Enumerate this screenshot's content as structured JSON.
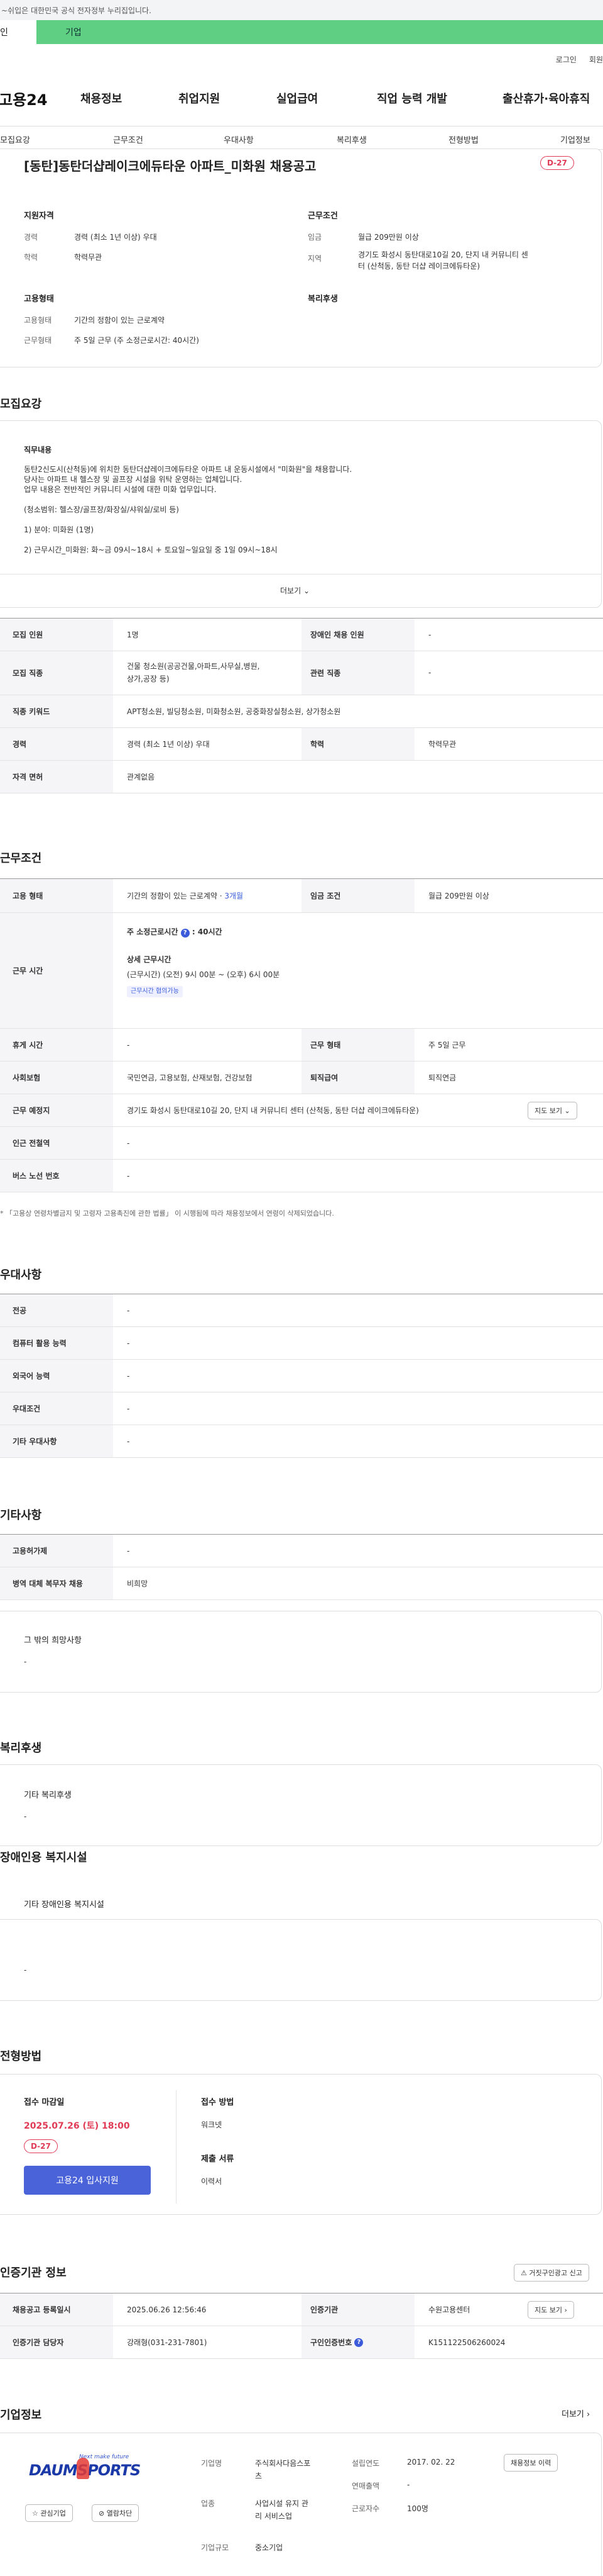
{
  "top_notice": "~쉬입은 대한민국 공식 전자정부 누리집입니다.",
  "service_tabs": {
    "personal": "인",
    "corporate": "기업"
  },
  "util": {
    "login": "로그인",
    "join": "회원"
  },
  "gnb": {
    "logo": "고용24",
    "menu": [
      "채용정보",
      "취업지원",
      "실업급여",
      "직업 능력 개발",
      "출산휴가·육아휴직"
    ]
  },
  "subnav": [
    "모집요강",
    "근무조건",
    "우대사항",
    "복리후생",
    "전형방법",
    "기업정보"
  ],
  "job": {
    "title": "[동탄]동탄더샵레이크에듀타운 아파트_미화원 채용공고",
    "dday": "D-27",
    "qual_heading": "지원자격",
    "career_k": "경력",
    "career_v": "경력 (최소 1년 이상) 우대",
    "edu_k": "학력",
    "edu_v": "학력무관",
    "cond_heading": "근무조건",
    "wage_k": "임금",
    "wage_v": "월급 209만원 이상",
    "area_k": "지역",
    "area_v1": "경기도 화성시 동탄대로10길 20, 단지 내 커뮤니티 센",
    "area_v2": "터 (산척동, 동탄 더샵 레이크에듀타운)",
    "emp_heading": "고용형태",
    "emptype_k": "고용형태",
    "emptype_v": "기간의 정함이 있는 근로계약",
    "worktype_k": "근무형태",
    "worktype_v": "주 5일 근무 (주 소정근로시간: 40시간)",
    "welfare_heading": "복리후생"
  },
  "recruit": {
    "heading": "모집요강",
    "duty_heading": "직무내용",
    "duty_lines": [
      "동탄2신도시(산척동)에 위치한 동탄더샵레이크에듀타운 아파트 내 운동시설에서 \"미화원\"을 채용합니다.",
      "당사는 아파트 내 헬스장 및 골프장 시설을 위탁 운영하는 업체입니다.",
      "업무 내용은 전반적인 커뮤니티 시설에 대한 미화 업무입니다.",
      "",
      "(청소범위: 헬스장/골프장/화장실/샤워실/로비 등)",
      "",
      "1) 분야: 미화원 (1명)",
      "",
      "2) 근무시간_미화원: 화~금 09시~18시 + 토요일~일요일 중 1일 09시~18시"
    ],
    "more": "더보기",
    "rows": [
      {
        "k1": "모집 인원",
        "v1": "1명",
        "k2": "장애인 채용 인원",
        "v2": "-"
      },
      {
        "k1": "모집 직종",
        "v1a": "건물 청소원(공공건물,아파트,사무실,병원,",
        "v1b": "상가,공장 등)",
        "k2": "관련 직종",
        "v2": "-"
      },
      {
        "k1": "직종 키워드",
        "v1": "APT청소원, 빌딩청소원, 미화청소원, 공중화장실청소원, 상가청소원"
      },
      {
        "k1": "경력",
        "v1": "경력 (최소 1년 이상) 우대",
        "k2": "학력",
        "v2": "학력무관"
      },
      {
        "k1": "자격 면허",
        "v1": "관계없음"
      }
    ]
  },
  "work": {
    "heading": "근무조건",
    "emp_k": "고용 형태",
    "emp_v": "기간의 정함이 있는 근로계약 · ",
    "emp_v_link": "3개월",
    "wage_k": "임금 조건",
    "wage_v": "월급 209만원 이상",
    "hours_k": "근무 시간",
    "hours_weekly": "주 소정근로시간",
    "hours_weekly_v": "40시간",
    "hours_detail_h": "상세 근무시간",
    "hours_detail_v": "(근무시간) (오전) 9시 00분 ~ (오후) 6시 00분",
    "hours_badge": "근무시간 협의가능",
    "rest_k": "휴게 시간",
    "rest_v": "-",
    "form_k": "근무 형태",
    "form_v": "주 5일 근무",
    "ins_k": "사회보험",
    "ins_v": "국민연금, 고용보험, 산재보험, 건강보험",
    "sev_k": "퇴직급여",
    "sev_v": "퇴직연금",
    "place_k": "근무 예정지",
    "place_v": "경기도 화성시 동탄대로10길 20, 단지 내 커뮤니티 센터 (산척동, 동탄 더샵 레이크에듀타운)",
    "map_btn": "지도 보기",
    "subway_k": "인근 전철역",
    "subway_v": "-",
    "bus_k": "버스 노선 번호",
    "bus_v": "-",
    "note": "* 「고용상 연령차별금지 및 고령자 고용촉진에 관한 법률」 이 시행됨에 따라 채용정보에서 연령이 삭제되었습니다."
  },
  "pref": {
    "heading": "우대사항",
    "rows": [
      {
        "k": "전공",
        "v": "-"
      },
      {
        "k": "컴퓨터 활용 능력",
        "v": "-"
      },
      {
        "k": "외국어 능력",
        "v": "-"
      },
      {
        "k": "우대조건",
        "v": "-"
      },
      {
        "k": "기타 우대사항",
        "v": "-"
      }
    ]
  },
  "etc": {
    "heading": "기타사항",
    "rows": [
      {
        "k": "고용허가제",
        "v": "-"
      },
      {
        "k": "병역 대체 복무자 채용",
        "v": "비희망"
      }
    ],
    "box_title": "그 밖의 희망사항",
    "box_v": "-"
  },
  "welfare": {
    "heading": "복리후생",
    "box_title": "기타 복리후생",
    "box_v": "-"
  },
  "disabled": {
    "heading": "장애인용 복지시설",
    "box_title": "기타 장애인용 복지시설",
    "box_v": "-"
  },
  "selection": {
    "heading": "전형방법",
    "deadline_h": "접수 마감일",
    "deadline_v": "2025.07.26 (토) 18:00",
    "dday": "D-27",
    "apply_btn": "고용24 입사지원",
    "method_h": "접수 방법",
    "method_v": "워크넷",
    "docs_h": "제출 서류",
    "docs_v": "이력서"
  },
  "cert": {
    "heading": "인증기관 정보",
    "report_btn": "거짓구인광고 신고",
    "reg_k": "채용공고 등록일시",
    "reg_v": "2025.06.26 12:56:46",
    "org_k": "인증기관",
    "org_v": "수원고용센터",
    "map_btn": "지도 보기",
    "mgr_k": "인증기관 담당자",
    "mgr_v": "강래형(031-231-7801)",
    "num_k": "구인인증번호",
    "num_v": "K151122506260024"
  },
  "company": {
    "heading": "기업정보",
    "more": "더보기",
    "logo_top": "Next make future",
    "logo_main": "DAUMSPORTS",
    "interest_btn": "관심기업",
    "block_btn": "열람차단",
    "name_k": "기업명",
    "name_v1": "주식회사다음스포",
    "name_v2": "츠",
    "ind_k": "업종",
    "ind_v1": "사업시설 유지 관",
    "ind_v2": "리 서비스업",
    "size_k": "기업규모",
    "size_v": "중소기업",
    "est_k": "설립연도",
    "est_v": "2017. 02. 22",
    "sales_k": "연매출액",
    "sales_v": "-",
    "emp_k": "근로자수",
    "emp_v": "100명",
    "other_jobs_btn": "채용정보 이력"
  }
}
